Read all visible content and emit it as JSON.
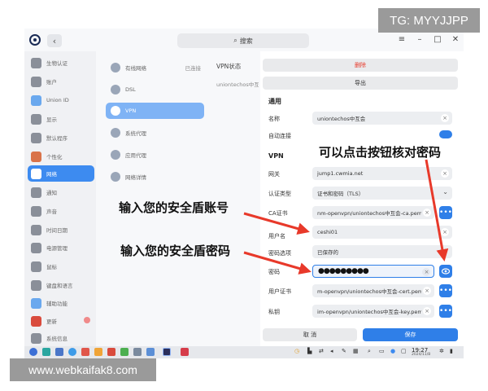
{
  "watermarks": {
    "top": "TG: MYYJJPP",
    "bottom": "www.webkaifak8.com"
  },
  "titlebar": {
    "back_icon": "‹",
    "search_placeholder": "搜索",
    "controls": [
      "≡",
      "–",
      "□",
      "✕"
    ]
  },
  "sidebar": {
    "items": [
      {
        "label": "生物认证"
      },
      {
        "label": "账户"
      },
      {
        "label": "Union ID"
      },
      {
        "label": "显示"
      },
      {
        "label": "默认程序"
      },
      {
        "label": "个性化"
      },
      {
        "label": "网络"
      },
      {
        "label": "通知"
      },
      {
        "label": "声音"
      },
      {
        "label": "时间日期"
      },
      {
        "label": "电源管理"
      },
      {
        "label": "鼠标"
      },
      {
        "label": "键盘和语言"
      },
      {
        "label": "辅助功能"
      },
      {
        "label": "更新"
      },
      {
        "label": "系统信息"
      }
    ]
  },
  "network_list": {
    "items": [
      {
        "label": "有线网络",
        "status": "已连接"
      },
      {
        "label": "DSL",
        "status": ""
      },
      {
        "label": "VPN",
        "status": ""
      },
      {
        "label": "系统代理",
        "status": ""
      },
      {
        "label": "应用代理",
        "status": ""
      },
      {
        "label": "网络详情",
        "status": ""
      }
    ]
  },
  "vpn_status": {
    "title": "VPN状态",
    "connection": "uniontechos中互"
  },
  "detail": {
    "delete_label": "删除",
    "export_label": "导出",
    "general_section": "通用",
    "name_label": "名称",
    "name_value": "uniontechos中互会",
    "auto_connect_label": "自动连接",
    "vpn_section": "VPN",
    "gateway_label": "网关",
    "gateway_value": "jump1.cwmia.net",
    "auth_type_label": "认证类型",
    "auth_type_value": "证书和密码（TLS）",
    "ca_label": "CA证书",
    "ca_value": "nm-openvpn/uniontechos中互会-ca.pem",
    "username_label": "用户名",
    "username_value": "ceshi01",
    "pw_option_label": "密码选项",
    "pw_option_value": "已保存的",
    "password_label": "密码",
    "password_value": "●●●●●●●●●",
    "user_cert_label": "用户证书",
    "user_cert_value": "m-openvpn/uniontechos中互会-cert.pem",
    "key_label": "私钥",
    "key_value": "im-openvpn/uniontechos中互会-key.pem",
    "cancel_label": "取 消",
    "save_label": "保存",
    "clear_glyph": "×",
    "dots_glyph": "•••"
  },
  "annotations": {
    "eye_hint": "可以点击按钮核对密码",
    "account_hint": "输入您的安全盾账号",
    "password_hint": "输入您的安全盾密码"
  },
  "taskbar": {
    "time": "19:27",
    "date": "2024/11/8"
  },
  "colors": {
    "accent": "#2f7fe8",
    "annotation_arrow": "#e8392a"
  }
}
